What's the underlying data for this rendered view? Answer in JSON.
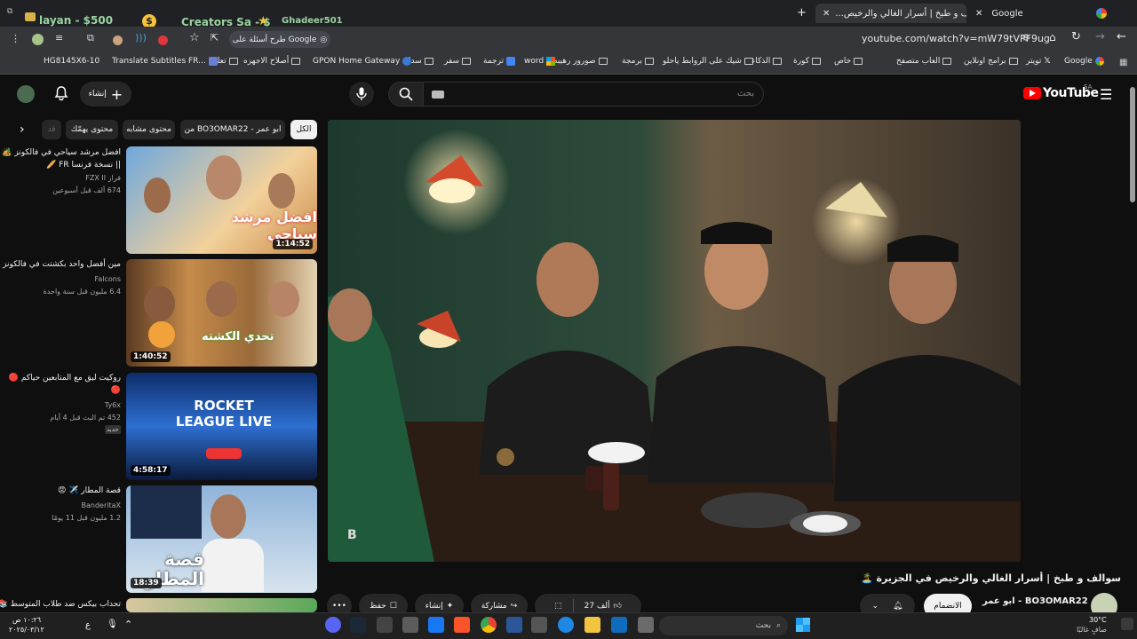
{
  "browser": {
    "tabs": [
      {
        "label": "Google",
        "active": false
      },
      {
        "label": "سوالف و طبخ | أسرار الغالي والرخيص...",
        "active": true
      }
    ],
    "left_tabs": [
      "layan - $500",
      "Creators Sa - $",
      "Ghadeer501"
    ],
    "url": "youtube.com/watch?v=mW79tVPF9ug",
    "google_prompt": "طرح أسئلة على Google",
    "bookmarks": [
      "Google",
      "تويتر",
      "برامج اونلاين",
      "العاب متصفح",
      "خاص",
      "كورة",
      "الذكاء",
      "شيك على الروابط ياحلو",
      "برمجة",
      "صورور رهيبه",
      "word",
      "ترجمة",
      "سفر",
      "سداد",
      "GPON Home Gateway",
      "أصلاح الاجهزه",
      "تعليم",
      "Translate Subtitles FR...",
      "HG8145X6-10"
    ]
  },
  "youtube": {
    "logo": "YouTube",
    "region": "SA",
    "search_placeholder": "بحث",
    "create_label": "إنشاء",
    "video_title": "سوالف و طبخ | أسرار الغالي والرخيص في الجزيرة 🏝️",
    "channel": "ابو عمر - BO3OMAR22",
    "join_label": "الانضمام",
    "likes": "27 ألف",
    "share_label": "مشاركة",
    "clip_label": "إنشاء",
    "save_label": "حفظ",
    "chips": [
      "الكل",
      "من BO3OMAR22 - ابو عمر",
      "محتوى مشابه",
      "محتوى يهمّك",
      "قد"
    ],
    "recommendations": [
      {
        "title1": "افضل مرشد سياحي في فالكونز 🏕️",
        "title2": "|| نسخة فرنسا FR 🥖",
        "channel": "فراز FZX II",
        "meta": "674 ألف   قبل أسبوعين",
        "duration": "1:14:52",
        "thumb_text": "افضل مرشد سياحي"
      },
      {
        "title1": "مين أفضل واحد بكشتت في فالكونز ؟",
        "title2": "",
        "channel": "Falcons",
        "meta": "6.4 مليون   قبل سنة واحدة",
        "duration": "1:40:52",
        "thumb_text": "تحدي الكشته"
      },
      {
        "title1": "روكيت ليق مع المتابعين حياكم 🔴",
        "title2": "🔴",
        "channel": "Ty6x",
        "meta": "452   تم البث قبل 4 أيام",
        "duration": "4:58:17",
        "thumb_text": "ROCKET LEAGUE LIVE",
        "badge": "جديد"
      },
      {
        "title1": "قصة المطار ✈️ 😡",
        "title2": "",
        "channel": "BanderitaX",
        "meta": "1.2 مليون   قبل 11 يومًا",
        "duration": "18:39",
        "thumb_text": "قصة المطار"
      },
      {
        "title1": "تحداب بيكس ضد طلاب المتوسط 📚",
        "title2": "",
        "channel": "",
        "meta": "",
        "duration": "",
        "thumb_text": ""
      }
    ]
  },
  "taskbar": {
    "search": "بحث",
    "weather_temp": "30°C",
    "weather_desc": "صافٍ غالبًا",
    "time": "١٠:٢٦ ص",
    "date": "٢٠٢٥/٠٣/١٢",
    "lang": "ع"
  }
}
